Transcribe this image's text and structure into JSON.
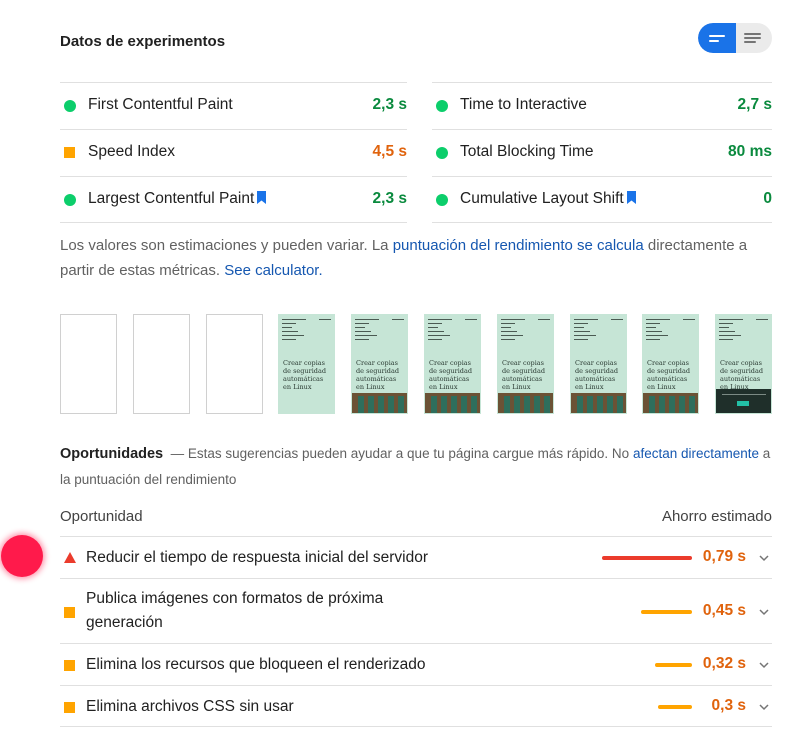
{
  "header": {
    "title": "Datos de experimentos"
  },
  "view_toggle": {
    "left_icon": "bars-icon",
    "right_icon": "list-icon"
  },
  "metrics": {
    "left": [
      {
        "label": "First Contentful Paint",
        "value": "2,3 s",
        "status": "green",
        "bookmark": false
      },
      {
        "label": "Speed Index",
        "value": "4,5 s",
        "status": "orange",
        "bookmark": false
      },
      {
        "label": "Largest Contentful Paint",
        "value": "2,3 s",
        "status": "green",
        "bookmark": true
      }
    ],
    "right": [
      {
        "label": "Time to Interactive",
        "value": "2,7 s",
        "status": "green",
        "bookmark": false
      },
      {
        "label": "Total Blocking Time",
        "value": "80 ms",
        "status": "green",
        "bookmark": false
      },
      {
        "label": "Cumulative Layout Shift",
        "value": "0",
        "status": "green",
        "bookmark": true
      }
    ]
  },
  "note": {
    "text1": "Los valores son estimaciones y pueden variar. La ",
    "link1": "puntuación del rendimiento se calcula",
    "text2": " directamente a partir de estas métricas. ",
    "link2": "See calculator."
  },
  "filmstrip": {
    "heading_text": "Crear copias de seguridad automáticas en Linux",
    "frames": [
      "blank",
      "blank",
      "blank",
      "text",
      "photo",
      "photo",
      "photo",
      "photo",
      "photo",
      "cookie"
    ]
  },
  "opportunities": {
    "title": "Oportunidades",
    "dash": "—",
    "description": "Estas sugerencias pueden ayudar a que tu página cargue más rápido. No ",
    "link": "afectan directamente",
    "description_end": " a la puntuación del rendimiento",
    "col_opportunity": "Oportunidad",
    "col_savings": "Ahorro estimado",
    "items": [
      {
        "label": "Reducir el tiempo de respuesta inicial del servidor",
        "value": "0,79 s",
        "severity": "red",
        "fraction": 1.0
      },
      {
        "label": "Publica imágenes con formatos de próxima generación",
        "value": "0,45 s",
        "severity": "orange",
        "fraction": 0.57
      },
      {
        "label": "Elimina los recursos que bloqueen el renderizado",
        "value": "0,32 s",
        "severity": "orange",
        "fraction": 0.41
      },
      {
        "label": "Elimina archivos CSS sin usar",
        "value": "0,3 s",
        "severity": "orange",
        "fraction": 0.38
      }
    ]
  },
  "colors": {
    "accent": "#1a73e8",
    "pass": "#0cce6b",
    "average": "#ffa400",
    "fail": "#eb3b2c",
    "link": "#1557b0"
  }
}
